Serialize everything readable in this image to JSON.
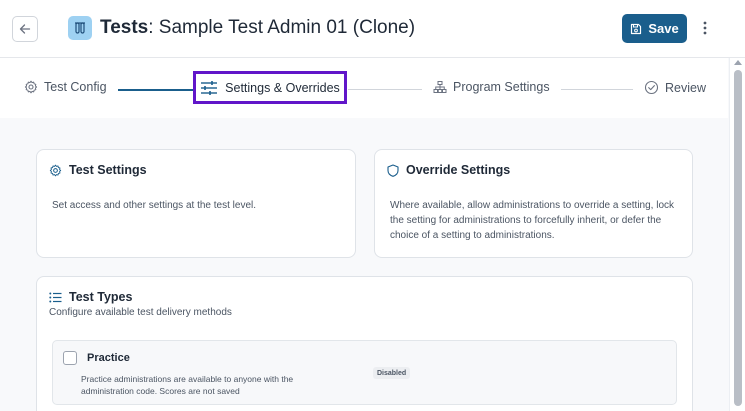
{
  "header": {
    "title_bold": "Tests",
    "title_rest": ": Sample Test Admin 01 (Clone)",
    "save_label": "Save",
    "icons": {
      "back": "arrow-left-icon",
      "app": "test-tubes-icon",
      "save": "floppy-disk-icon",
      "more": "more-vertical-icon"
    },
    "colors": {
      "save_bg": "#1a5e8c",
      "app_icon_bg": "#9ed1f2"
    }
  },
  "stepper": {
    "steps": [
      {
        "label": "Test Config",
        "icon": "gear-icon"
      },
      {
        "label": "Settings & Overrides",
        "icon": "sliders-icon"
      },
      {
        "label": "Program Settings",
        "icon": "sitemap-icon"
      },
      {
        "label": "Review",
        "icon": "check-circle-icon"
      }
    ],
    "active_index": 1,
    "colors": {
      "active_outline": "#6116c9",
      "completed_line": "#1a5e8c",
      "pending_line": "#d1d5db"
    }
  },
  "test_settings": {
    "title": "Test Settings",
    "description": "Set access and other settings at the test level.",
    "icon": "gear-icon"
  },
  "override_settings": {
    "title": "Override Settings",
    "description": "Where available, allow administrations to override a setting, lock the setting for administrations to forcefully inherit, or defer the choice of a setting to administrations.",
    "icon": "shield-icon"
  },
  "test_types": {
    "title": "Test Types",
    "subtitle": "Configure available test delivery methods",
    "icon": "list-icon",
    "items": [
      {
        "name": "Practice",
        "description": "Practice administrations are available to anyone with the administration code. Scores are not saved",
        "status": "Disabled",
        "checked": false
      }
    ]
  }
}
